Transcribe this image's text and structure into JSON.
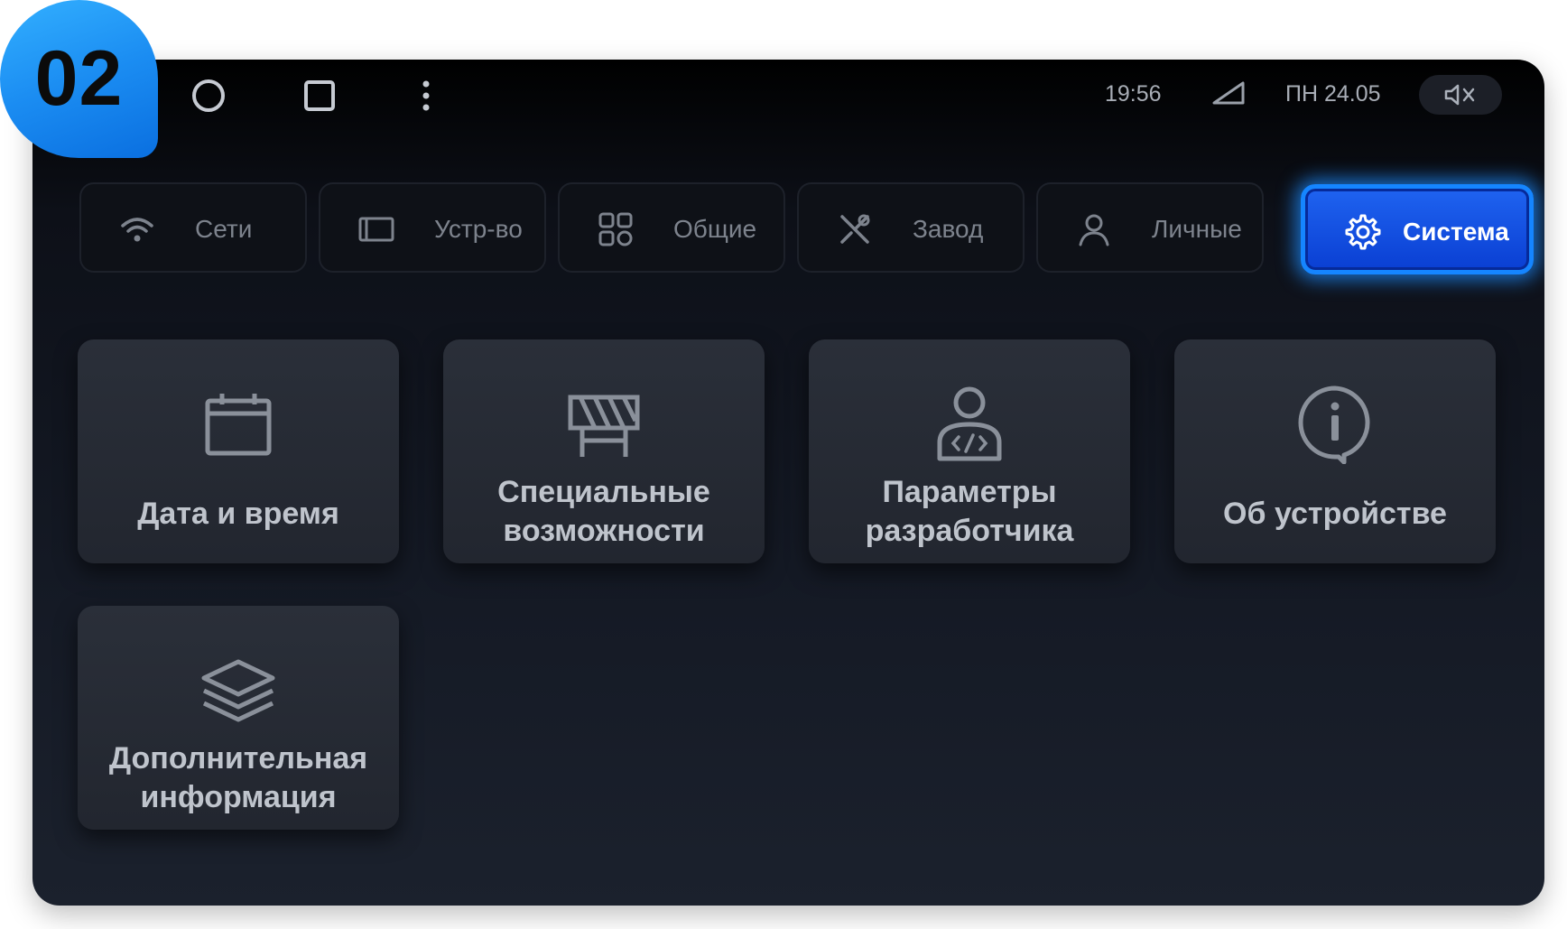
{
  "step_badge": {
    "label": "02"
  },
  "status_bar": {
    "nav": [
      {
        "name": "home-circle-icon"
      },
      {
        "name": "recent-apps-square-icon"
      },
      {
        "name": "more-vertical-icon"
      }
    ],
    "time": "19:56",
    "signal_icon": "signal-icon",
    "date": "ПН 24.05",
    "volume_icon": "volume-muted-icon"
  },
  "tabs": [
    {
      "label": "Сети",
      "icon": "wifi-icon",
      "active": false
    },
    {
      "label": "Устр-во",
      "icon": "screen-icon",
      "active": false
    },
    {
      "label": "Общие",
      "icon": "grid-icon",
      "active": false
    },
    {
      "label": "Завод",
      "icon": "tools-icon",
      "active": false
    },
    {
      "label": "Личные",
      "icon": "user-icon",
      "active": false
    },
    {
      "label": "Система",
      "icon": "gear-icon",
      "active": true
    }
  ],
  "tiles": [
    {
      "label_lines": [
        "Дата и время"
      ],
      "icon": "calendar-icon"
    },
    {
      "label_lines": [
        "Специальные",
        "возможности"
      ],
      "icon": "barrier-icon"
    },
    {
      "label_lines": [
        "Параметры",
        "разработчика"
      ],
      "icon": "developer-icon"
    },
    {
      "label_lines": [
        "Об устройстве"
      ],
      "icon": "info-icon"
    },
    {
      "label_lines": [
        "Дополнительная",
        "информация"
      ],
      "icon": "layers-icon"
    }
  ],
  "colors": {
    "accent": "#1a5cf0",
    "accent_glow": "#1585ff",
    "badge": "#1b8df2"
  }
}
